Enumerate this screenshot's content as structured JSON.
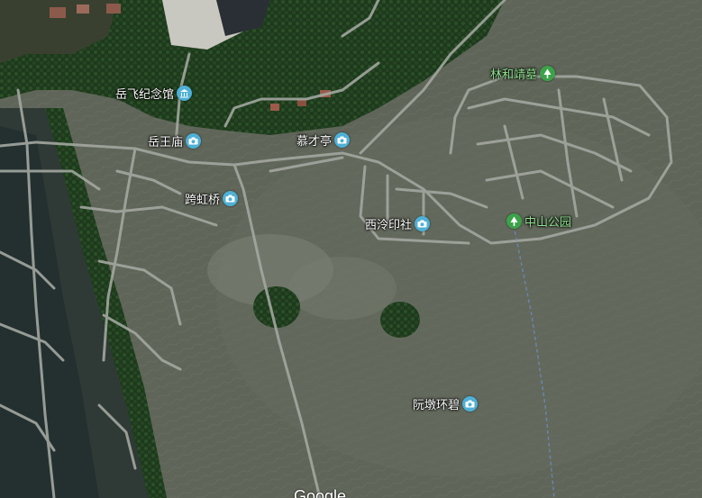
{
  "map": {
    "attribution": "Google",
    "colors": {
      "poi_pin": "#4fb0d6",
      "park_pin": "#3ca24a",
      "label_text": "#ffffff",
      "park_text": "#8fe28f",
      "road": "#a3a7a0"
    },
    "places": [
      {
        "label": "岳飞纪念馆",
        "type": "museum",
        "icon": "museum-icon"
      },
      {
        "label": "岳王庙",
        "type": "photo",
        "icon": "camera-icon"
      },
      {
        "label": "慕才亭",
        "type": "photo",
        "icon": "camera-icon"
      },
      {
        "label": "跨虹桥",
        "type": "photo",
        "icon": "camera-icon"
      },
      {
        "label": "林和靖墓",
        "type": "park",
        "icon": "tree-icon"
      },
      {
        "label": "西泠印社",
        "type": "photo",
        "icon": "camera-icon"
      },
      {
        "label": "中山公园",
        "type": "park",
        "icon": "tree-icon"
      },
      {
        "label": "阮墩环碧",
        "type": "photo",
        "icon": "camera-icon"
      }
    ]
  }
}
